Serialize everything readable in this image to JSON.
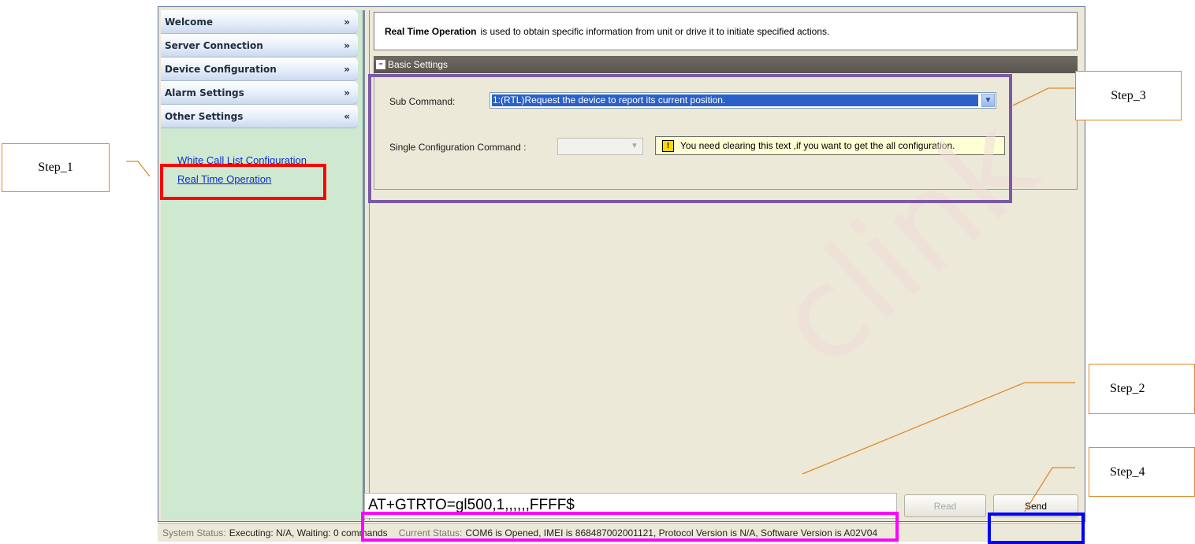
{
  "sidebar": {
    "headers": [
      {
        "label": "Welcome",
        "chevron": "double-chevron-down"
      },
      {
        "label": "Server Connection",
        "chevron": "double-chevron-down"
      },
      {
        "label": "Device Configuration",
        "chevron": "double-chevron-down"
      },
      {
        "label": "Alarm Settings",
        "chevron": "double-chevron-down"
      },
      {
        "label": "Other Settings",
        "chevron": "double-chevron-up"
      }
    ],
    "links": [
      {
        "label": "White Call List Configuration"
      },
      {
        "label": "Real Time Operation"
      }
    ]
  },
  "main": {
    "intro_title": "Real Time Operation",
    "intro_text": "is used to obtain specific information from unit or drive it to initiate specified actions.",
    "section_title": "Basic Settings",
    "sub_command_label": "Sub Command:",
    "sub_command_value": "1:(RTL)Request the device to report its current position.",
    "single_config_label": "Single Configuration Command :",
    "single_config_value": "",
    "tooltip_text": "You need clearing this text ,if you want to get the all configuration.",
    "watermark": "clink",
    "command_value": "AT+GTRTO=gl500,1,,,,,,FFFF$",
    "read_button": "Read",
    "send_button": "Send"
  },
  "status": {
    "system_label": "System Status:",
    "system_value": "Executing: N/A, Waiting: 0 commands",
    "current_label": "Current Status:",
    "current_value": "COM6 is Opened, IMEI is 868487002001121, Protocol Version is N/A, Software Version is A02V04"
  },
  "annotations": {
    "step1": "Step_1",
    "step2": "Step_2",
    "step3": "Step_3",
    "step4": "Step_4",
    "line_color": "#e08a2a"
  },
  "colors": {
    "step1_highlight": "#ff0000",
    "step2_highlight": "#ff00ff",
    "step3_highlight": "#7a5aa6",
    "step4_highlight": "#0000ff"
  }
}
